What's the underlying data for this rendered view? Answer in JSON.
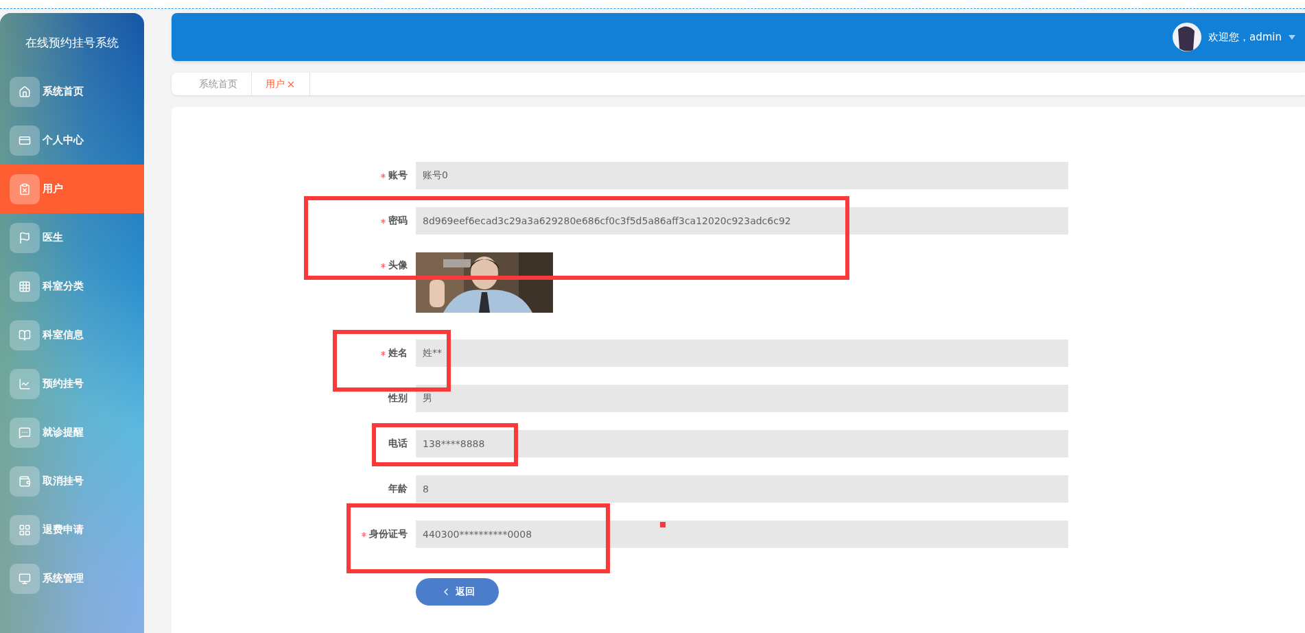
{
  "sidebar": {
    "title": "在线预约挂号系统",
    "items": [
      {
        "label": "系统首页",
        "selected": false
      },
      {
        "label": "个人中心",
        "selected": false
      },
      {
        "label": "用户",
        "selected": true
      },
      {
        "label": "医生",
        "selected": false
      },
      {
        "label": "科室分类",
        "selected": false
      },
      {
        "label": "科室信息",
        "selected": false
      },
      {
        "label": "预约挂号",
        "selected": false
      },
      {
        "label": "就诊提醒",
        "selected": false
      },
      {
        "label": "取消挂号",
        "selected": false
      },
      {
        "label": "退费申请",
        "selected": false
      },
      {
        "label": "系统管理",
        "selected": false
      }
    ]
  },
  "header": {
    "greeting": "欢迎您，admin"
  },
  "tabs": [
    {
      "label": "系统首页",
      "selected": false,
      "closable": false
    },
    {
      "label": "用户",
      "selected": true,
      "closable": true
    }
  ],
  "form": {
    "fields": [
      {
        "kind": "text",
        "label": "账号",
        "required": true,
        "value": "账号0"
      },
      {
        "kind": "text",
        "label": "密码",
        "required": true,
        "value": "8d969eef6ecad3c29a3a629280e686cf0c3f5d5a86aff3ca12020c923adc6c92"
      },
      {
        "label": "头像",
        "required": true
      },
      {
        "kind": "text",
        "label": "姓名",
        "required": true,
        "value": "姓**"
      },
      {
        "kind": "text",
        "label": "性别",
        "required": false,
        "value": "男"
      },
      {
        "kind": "text",
        "label": "电话",
        "required": false,
        "value": "138****8888"
      },
      {
        "kind": "text",
        "label": "年龄",
        "required": false,
        "value": "8"
      },
      {
        "kind": "text",
        "label": "身份证号",
        "required": true,
        "value": "440300**********0008"
      }
    ],
    "back_button": "返回"
  }
}
